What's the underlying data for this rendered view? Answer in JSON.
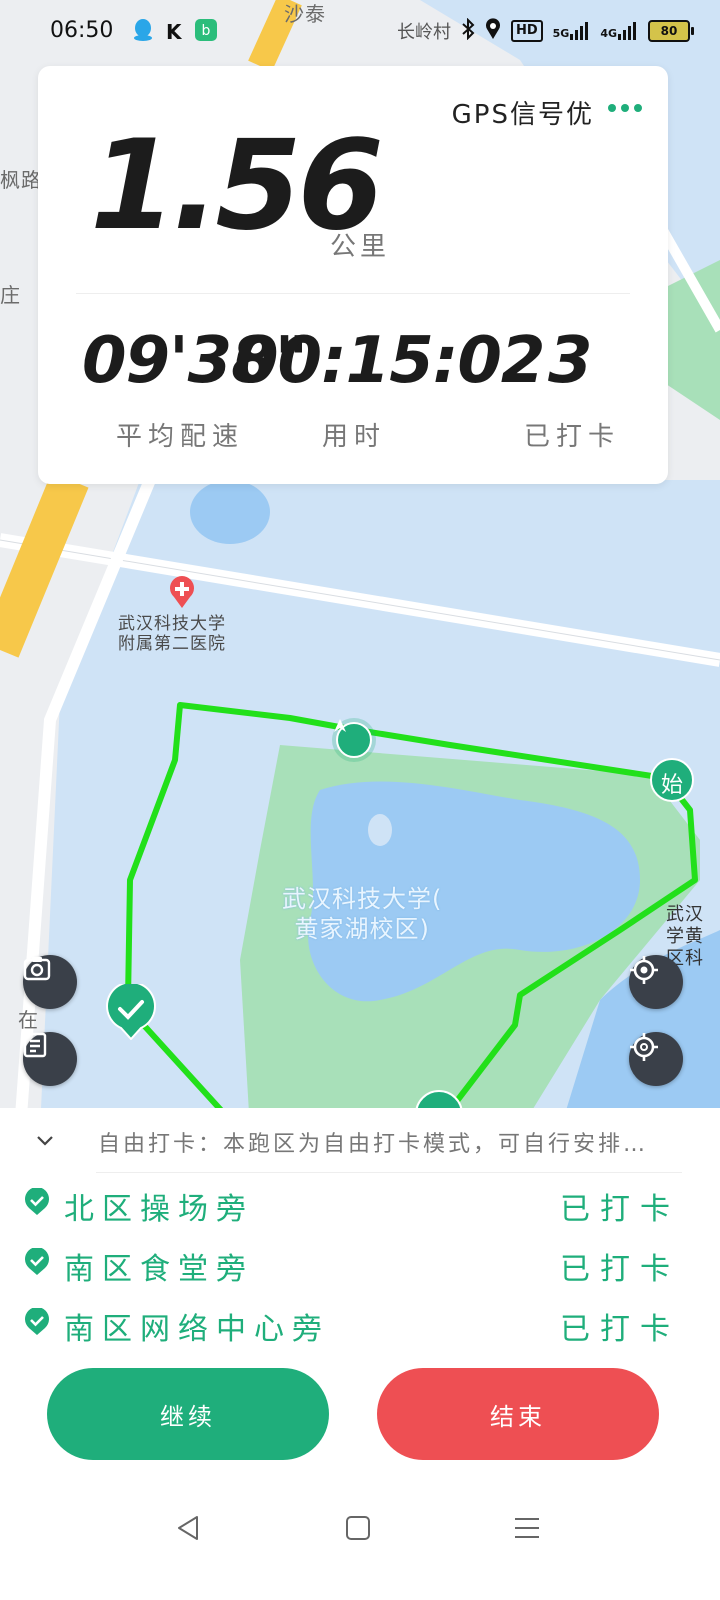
{
  "status_bar": {
    "time": "06:50",
    "village": "长岭村",
    "network_hd": "HD",
    "network_5g": "5G",
    "network_4g": "4G",
    "battery": "80"
  },
  "map": {
    "hospital_name": "武汉科技大学\n附属第二医院",
    "campus_name": "武汉科技大学(\n黄家湖校区)",
    "road_top": "沙泰",
    "road_left": "枫路",
    "edge_left_1": "庄",
    "edge_left_2": "在",
    "edge_right": "武汉\n学黄\n区科",
    "start_marker_label": "始",
    "route_color": "#22e01a",
    "accent_green": "#1fae7b"
  },
  "stats": {
    "gps_status": "GPS信号优",
    "distance": "1.56",
    "distance_unit": "公里",
    "pace": "09'38\"",
    "duration": "00:15:02",
    "checkins": "3",
    "pace_label": "平均配速",
    "duration_label": "用时",
    "checkins_label": "已打卡"
  },
  "panel": {
    "notice": "自由打卡：本跑区为自由打卡模式，可自行安排…",
    "checkpoints": [
      {
        "name": "北区操场旁",
        "status": "已打卡"
      },
      {
        "name": "南区食堂旁",
        "status": "已打卡"
      },
      {
        "name": "南区网络中心旁",
        "status": "已打卡"
      }
    ],
    "continue_label": "继续",
    "end_label": "结束",
    "continue_color": "#1fae7b",
    "end_color": "#ee4f53"
  },
  "icons": {
    "camera": "camera-icon",
    "notes": "notes-icon",
    "locate": "locate-icon",
    "recenter": "recenter-icon",
    "chevron": "chevron-down-icon",
    "check": "check-circle-icon",
    "nav_back": "nav-back-icon",
    "nav_home": "nav-home-icon",
    "nav_menu": "nav-menu-icon"
  }
}
